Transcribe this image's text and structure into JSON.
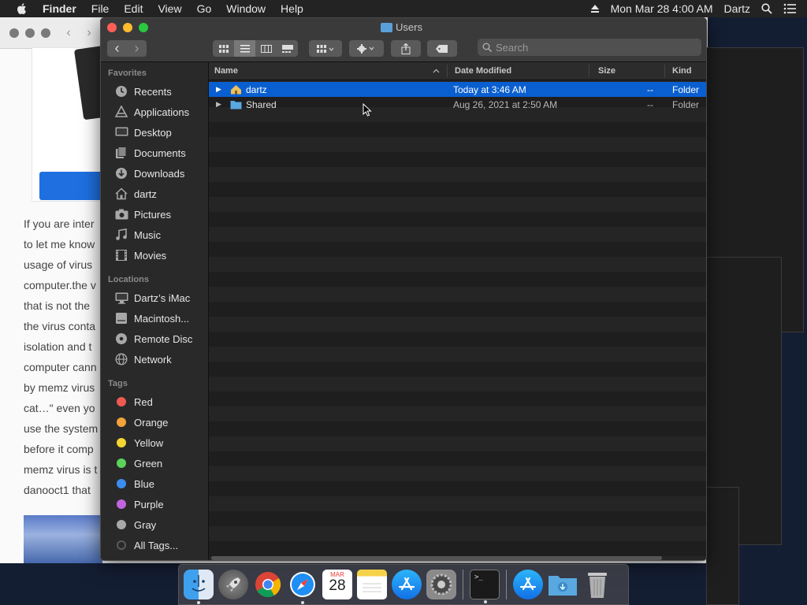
{
  "menubar": {
    "app_name": "Finder",
    "items": [
      "File",
      "Edit",
      "View",
      "Go",
      "Window",
      "Help"
    ],
    "clock": "Mon Mar 28  4:00 AM",
    "user": "Dartz"
  },
  "background_article": {
    "lines": [
      "If you are inter",
      "to let me know",
      "usage of virus",
      "computer.the v",
      "that is not the",
      "the virus conta",
      "isolation and t",
      "computer cann",
      "by memz virus",
      "cat…\" even yo",
      "use the system",
      "before it comp",
      "memz virus is t",
      "danooct1 that"
    ]
  },
  "finder": {
    "window_title": "Users",
    "search": {
      "placeholder": "Search"
    },
    "sidebar": {
      "favorites_header": "Favorites",
      "favorites": [
        {
          "label": "Recents",
          "icon": "clock-icon"
        },
        {
          "label": "Applications",
          "icon": "applications-icon"
        },
        {
          "label": "Desktop",
          "icon": "desktop-icon"
        },
        {
          "label": "Documents",
          "icon": "document-icon"
        },
        {
          "label": "Downloads",
          "icon": "download-icon"
        },
        {
          "label": "dartz",
          "icon": "home-icon"
        },
        {
          "label": "Pictures",
          "icon": "camera-icon"
        },
        {
          "label": "Music",
          "icon": "music-note-icon"
        },
        {
          "label": "Movies",
          "icon": "film-icon"
        }
      ],
      "locations_header": "Locations",
      "locations": [
        {
          "label": "Dartz’s iMac",
          "icon": "computer-icon"
        },
        {
          "label": "Macintosh...",
          "icon": "hard-drive-icon"
        },
        {
          "label": "Remote Disc",
          "icon": "disc-icon"
        },
        {
          "label": "Network",
          "icon": "globe-icon"
        }
      ],
      "tags_header": "Tags",
      "tags": [
        {
          "label": "Red",
          "color": "#ee5a52"
        },
        {
          "label": "Orange",
          "color": "#f2a33a"
        },
        {
          "label": "Yellow",
          "color": "#f5d630"
        },
        {
          "label": "Green",
          "color": "#5bd35b"
        },
        {
          "label": "Blue",
          "color": "#3b8ef0"
        },
        {
          "label": "Purple",
          "color": "#c064e0"
        },
        {
          "label": "Gray",
          "color": "#a8a8a8"
        },
        {
          "label": "All Tags...",
          "color": "#5a5a5a"
        }
      ]
    },
    "columns": {
      "name": "Name",
      "date_modified": "Date Modified",
      "size": "Size",
      "kind": "Kind"
    },
    "rows": [
      {
        "name": "dartz",
        "date": "Today at 3:46 AM",
        "size": "--",
        "kind": "Folder",
        "selected": true,
        "icon": "home-folder-icon"
      },
      {
        "name": "Shared",
        "date": "Aug 26, 2021 at 2:50 AM",
        "size": "--",
        "kind": "Folder",
        "selected": false,
        "icon": "folder-icon"
      }
    ]
  },
  "dock": {
    "apps": [
      "Finder",
      "Launchpad",
      "Chrome",
      "Safari",
      "Calendar",
      "Notes",
      "App Store",
      "System Preferences",
      "Terminal",
      "Applications",
      "Downloads",
      "Trash"
    ],
    "calendar_month": "MAR",
    "calendar_day": "28"
  }
}
